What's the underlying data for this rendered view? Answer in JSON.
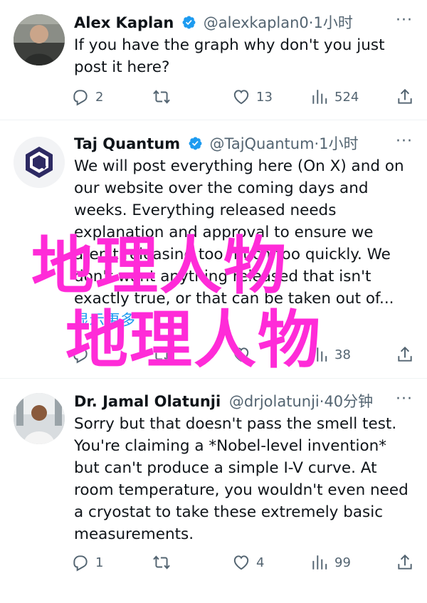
{
  "tweets": [
    {
      "name": "Alex Kaplan",
      "handle": "@alexkaplan0",
      "time": "1小时",
      "dot": "·",
      "text": "If you have the graph why don't you just post it here?",
      "replies": "2",
      "retweets": "",
      "likes": "13",
      "views": "524"
    },
    {
      "name": "Taj Quantum",
      "handle": "@TajQuantum",
      "time": "1小时",
      "dot": "·",
      "text": "We will post everything here (On X) and on our website over the coming days and weeks. Everything released needs explanation and approval to ensure we aren't releasing too much too quickly. We don't want anything released that isn't exactly true, or that can be taken out of...",
      "show_more": "显示更多",
      "replies": "",
      "retweets": "",
      "likes": "",
      "views": "38"
    },
    {
      "name": "Dr. Jamal Olatunji",
      "handle": "@drjolatunji",
      "time": "40分钟",
      "dot": "·",
      "text": "Sorry but that doesn't pass the smell test. You're claiming a *Nobel-level invention* but can't produce a simple I-V curve. At room temperature, you wouldn't even need a cryostat to take these extremely basic measurements.",
      "replies": "1",
      "retweets": "",
      "likes": "4",
      "views": "99"
    }
  ],
  "more_glyph": "···",
  "overlay": {
    "line1": "地理人物",
    "line2": "地理人物",
    "color": "#ff2bd8"
  },
  "colors": {
    "verified": "#1d9bf0",
    "secondary": "#536471",
    "text": "#0f1419"
  },
  "icons": [
    "reply-icon",
    "retweet-icon",
    "like-icon",
    "views-icon",
    "share-icon",
    "verified-badge-icon",
    "more-icon"
  ]
}
